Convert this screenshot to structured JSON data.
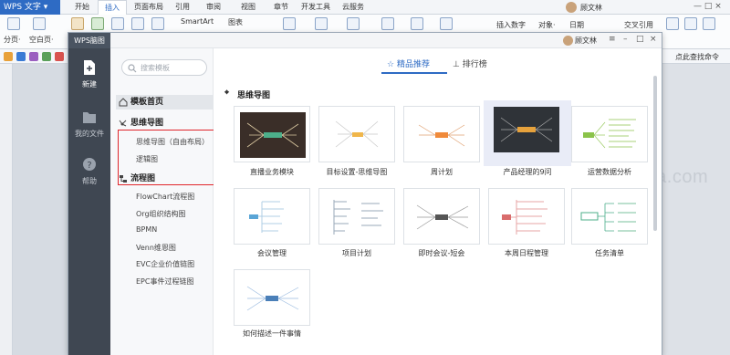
{
  "app": {
    "name": "WPS 文字"
  },
  "tabs": [
    "开始",
    "插入",
    "页面布局",
    "引用",
    "审阅",
    "视图",
    "章节",
    "开发工具",
    "云服务"
  ],
  "active_tab": "插入",
  "ribbon": {
    "page_break": "分页·",
    "blank_page": "空白页·",
    "smartart": "SmartArt",
    "chart": "图表",
    "insert_number": "插入数字",
    "object": "对象·",
    "date": "日期",
    "cross_ref": "交叉引用",
    "find_cmd": "点此查找命令"
  },
  "dialog": {
    "title": "WPS脑图",
    "user": "顾文林",
    "nav": [
      {
        "label": "新建",
        "icon": "new-file-icon"
      },
      {
        "label": "我的文件",
        "icon": "folder-icon"
      },
      {
        "label": "帮助",
        "icon": "help-icon"
      }
    ],
    "search_placeholder": "搜索模板",
    "categories": {
      "home": "模板首页",
      "mindmap": "思维导图",
      "mindmap_free": "思维导图（自由布局）",
      "logic": "逻辑图",
      "flow": "流程图",
      "flow_items": [
        "FlowChart流程图",
        "Org组织结构图",
        "BPMN",
        "Venn维恩图",
        "EVC企业价值链图",
        "EPC事件过程链图"
      ]
    },
    "content_tabs": [
      "精品推荐",
      "排行榜"
    ],
    "section_title": "思维导图",
    "templates": [
      "直播业务模块",
      "目标设置-思维导图",
      "周计划",
      "产品经理的9问",
      "运营数据分析",
      "会议管理",
      "项目计划",
      "即时会议-短会",
      "本周日程管理",
      "任务清单",
      "如何描述一件事情"
    ]
  },
  "watermark": "tuhuaba.com",
  "colors": {
    "accent": "#2e6bc4",
    "nav_bg": "#3f4752",
    "highlight_box": "#e0252b"
  }
}
